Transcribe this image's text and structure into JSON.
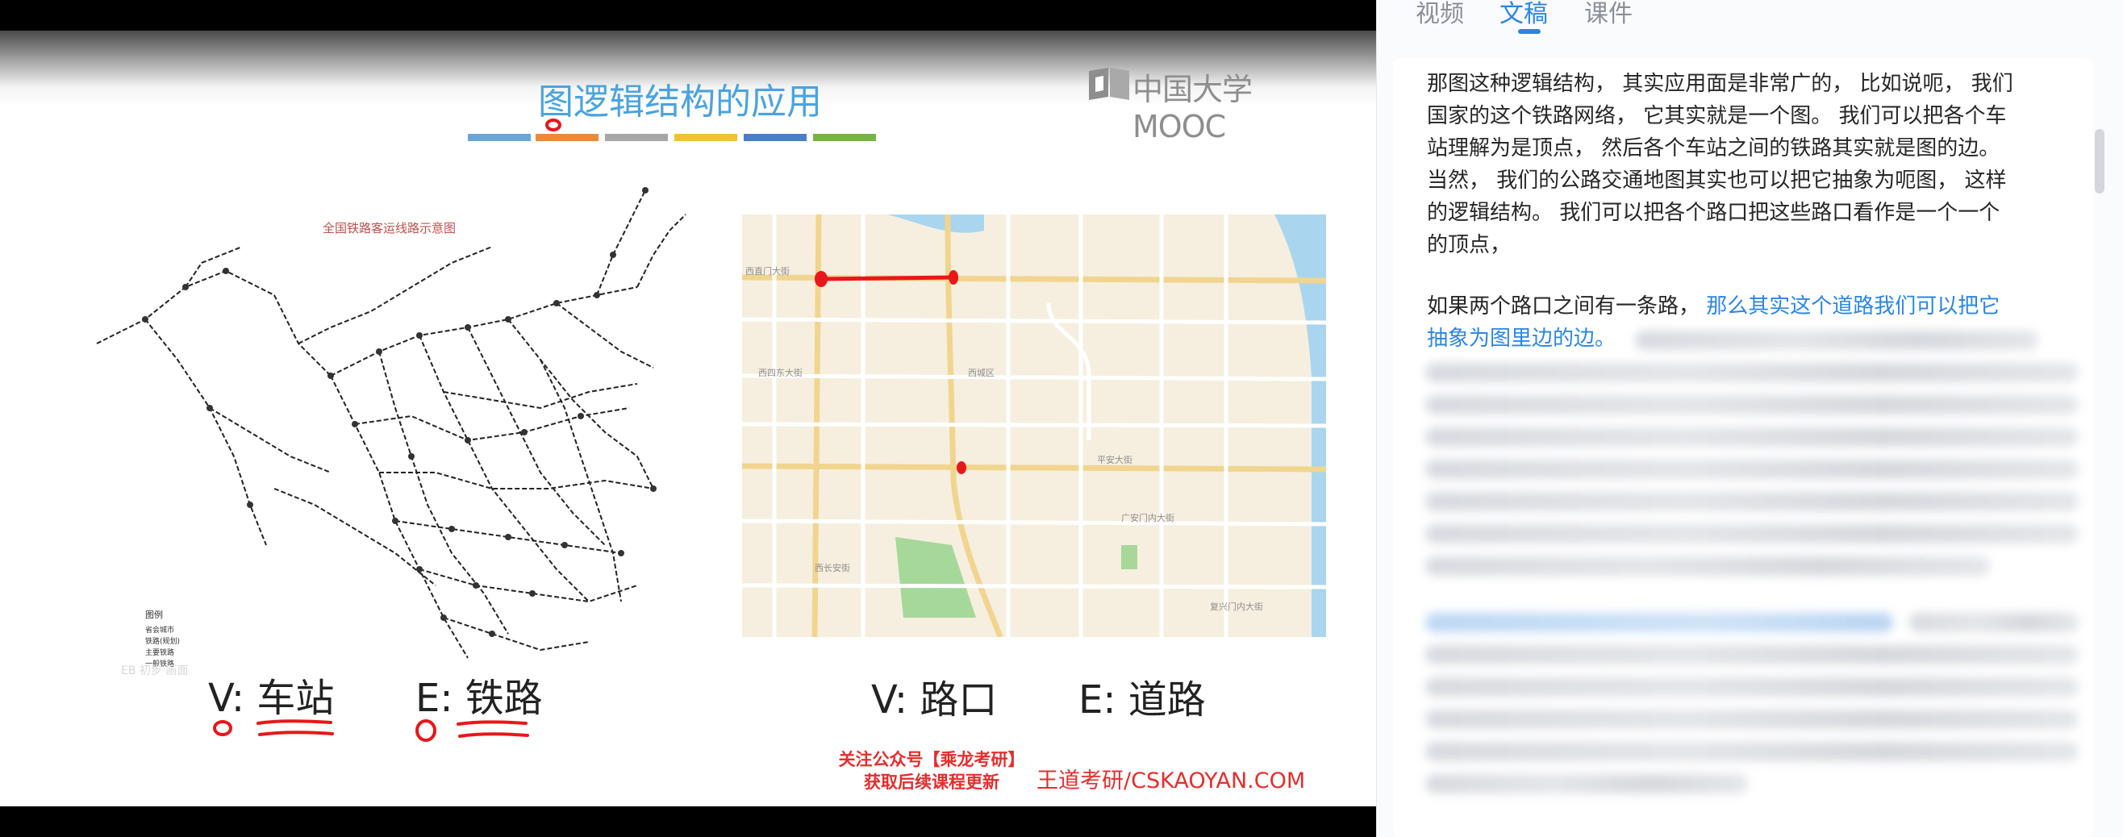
{
  "slide": {
    "title": "图逻辑结构的应用",
    "logo_text": "中国大学MOOC",
    "color_bar": [
      "#6aa6d9",
      "#ec8a3c",
      "#a7a7a7",
      "#f1c232",
      "#4a7fc6",
      "#77b347"
    ],
    "rail_map_title": "全国铁路客运线路示意图",
    "rail_legend_title": "图例",
    "rail_legend_items": [
      "省会城市",
      "铁路(规划)",
      "主要铁路",
      "一般铁路"
    ],
    "rail_watermark": "EB 初步 画面",
    "labels": {
      "v1_prefix": "V:",
      "v1_word": "车站",
      "e1_prefix": "E:",
      "e1_word": "铁路",
      "v2_prefix": "V:",
      "v2_word": "路口",
      "e2_prefix": "E:",
      "e2_word": "道路"
    },
    "street_labels": [
      "西直门大街",
      "西四东大街",
      "平安大街",
      "西长安街",
      "复兴门内大街",
      "广安门内大街",
      "西城区"
    ],
    "promo_line1": "关注公众号【乘龙考研】",
    "promo_line2": "获取后续课程更新",
    "site": "王道考研/CSKAOYAN.COM"
  },
  "panel": {
    "tabs": [
      "视频",
      "文稿",
      "课件"
    ],
    "active_tab": "文稿",
    "paragraph1_lines": [
      "那图这种逻辑结构， 其实应用面是非常广的， 比如说呃， 我们",
      "国家的这个铁路网络， 它其实就是一个图。 我们可以把各个车",
      "站理解为是顶点， 然后各个车站之间的铁路其实就是图的边。",
      " 当然， 我们的公路交通地图其实也可以把它抽象为呃图， 这样",
      "的逻辑结构。 我们可以把各个路口把这些路口看作是一个一个",
      "的顶点，"
    ],
    "paragraph2_line1_plain": "如果两个路口之间有一条路， ",
    "paragraph2_line1_highlight": "那么其实这个道路我们可以把它",
    "paragraph2_line2_highlight": "抽象为图里边的边。"
  },
  "colors": {
    "accent_blue": "#2a86e6",
    "title_blue": "#4aa3e0",
    "promo_red": "#e62d2d",
    "ink_red": "#e8171a"
  }
}
